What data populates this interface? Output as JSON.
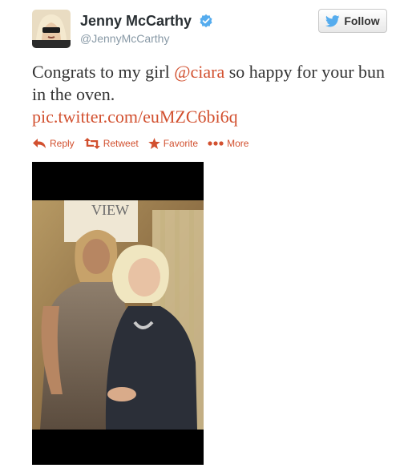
{
  "user": {
    "name": "Jenny McCarthy",
    "handle": "@JennyMcCarthy",
    "avatar_icon": "avatar-photo",
    "verified_icon": "verified-badge-icon",
    "verified_color": "#55acee"
  },
  "follow_button": {
    "label": "Follow",
    "icon": "twitter-bird-icon"
  },
  "tweet": {
    "text_before": "Congrats to my girl ",
    "mention": "@ciara",
    "text_after": "  so happy for your bun in the oven.",
    "link": "pic.twitter.com/euMZC6bi6q",
    "link_color": "#d2502f"
  },
  "actions": [
    {
      "label": "Reply",
      "icon": "reply-icon"
    },
    {
      "label": "Retweet",
      "icon": "retweet-icon"
    },
    {
      "label": "Favorite",
      "icon": "star-icon"
    },
    {
      "label": "More",
      "icon": "more-dots-icon"
    }
  ],
  "photo": {
    "sign_text": "VIEW"
  }
}
